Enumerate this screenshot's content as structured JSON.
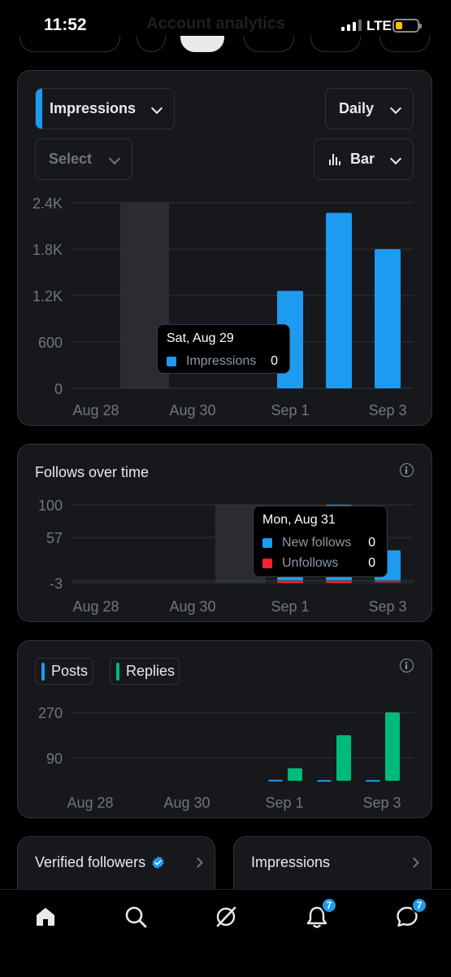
{
  "status_bar": {
    "time": "11:52",
    "network": "LTE"
  },
  "header": {
    "title": "Account analytics"
  },
  "impressions_card": {
    "metric_dropdown": "Impressions",
    "interval_dropdown": "Daily",
    "compare_dropdown": "Select",
    "chart_type_dropdown": "Bar",
    "tooltip": {
      "date": "Sat, Aug 29",
      "label": "Impressions",
      "value": "0"
    }
  },
  "follows_card": {
    "title": "Follows over time",
    "tooltip": {
      "date": "Mon, Aug 31",
      "rows": [
        {
          "label": "New follows",
          "value": "0"
        },
        {
          "label": "Unfollows",
          "value": "0"
        }
      ]
    }
  },
  "posts_card": {
    "legend": [
      "Posts",
      "Replies"
    ]
  },
  "mini_cards": [
    {
      "title": "Verified followers"
    },
    {
      "title": "Impressions"
    }
  ],
  "nav": {
    "notifications_badge": "7",
    "messages_badge": "7"
  },
  "colors": {
    "blue": "#1d9bf0",
    "green": "#00ba7c",
    "red": "#f4212e"
  },
  "chart_data": [
    {
      "type": "bar",
      "title": "",
      "x_ticks": [
        "Aug 28",
        "Aug 30",
        "Sep 1",
        "Sep 3"
      ],
      "y_ticks": [
        "2.4K",
        "1.8K",
        "1.2K",
        "600",
        "0"
      ],
      "ylim": [
        0,
        2400
      ],
      "categories": [
        "Aug 28",
        "Aug 29",
        "Aug 30",
        "Aug 31",
        "Sep 1",
        "Sep 2",
        "Sep 3"
      ],
      "series": [
        {
          "name": "Impressions",
          "values": [
            0,
            0,
            0,
            0,
            1260,
            2270,
            1800
          ],
          "color": "#1d9bf0"
        }
      ],
      "highlight_category": "Aug 29"
    },
    {
      "type": "bar",
      "title": "Follows over time",
      "x_ticks": [
        "Aug 28",
        "Aug 30",
        "Sep 1",
        "Sep 3"
      ],
      "y_ticks": [
        "100",
        "57",
        "-3"
      ],
      "ylim": [
        -3,
        100
      ],
      "categories": [
        "Aug 28",
        "Aug 29",
        "Aug 30",
        "Aug 31",
        "Sep 1",
        "Sep 2",
        "Sep 3"
      ],
      "series": [
        {
          "name": "New follows",
          "values": [
            0,
            0,
            0,
            0,
            5,
            100,
            40
          ],
          "color": "#1d9bf0"
        },
        {
          "name": "Unfollows",
          "values": [
            0,
            0,
            0,
            0,
            -3,
            -3,
            -1
          ],
          "color": "#f4212e"
        }
      ],
      "highlight_category": "Aug 31"
    },
    {
      "type": "bar",
      "title": "",
      "x_ticks": [
        "Aug 28",
        "Aug 30",
        "Sep 1",
        "Sep 3"
      ],
      "y_ticks": [
        "270",
        "90"
      ],
      "ylim": [
        0,
        270
      ],
      "categories": [
        "Aug 28",
        "Aug 29",
        "Aug 30",
        "Aug 31",
        "Sep 1",
        "Sep 2",
        "Sep 3"
      ],
      "series": [
        {
          "name": "Posts",
          "values": [
            0,
            0,
            0,
            0,
            4,
            3,
            3
          ],
          "color": "#1d9bf0"
        },
        {
          "name": "Replies",
          "values": [
            0,
            0,
            0,
            0,
            50,
            180,
            270
          ],
          "color": "#00ba7c"
        }
      ]
    }
  ]
}
